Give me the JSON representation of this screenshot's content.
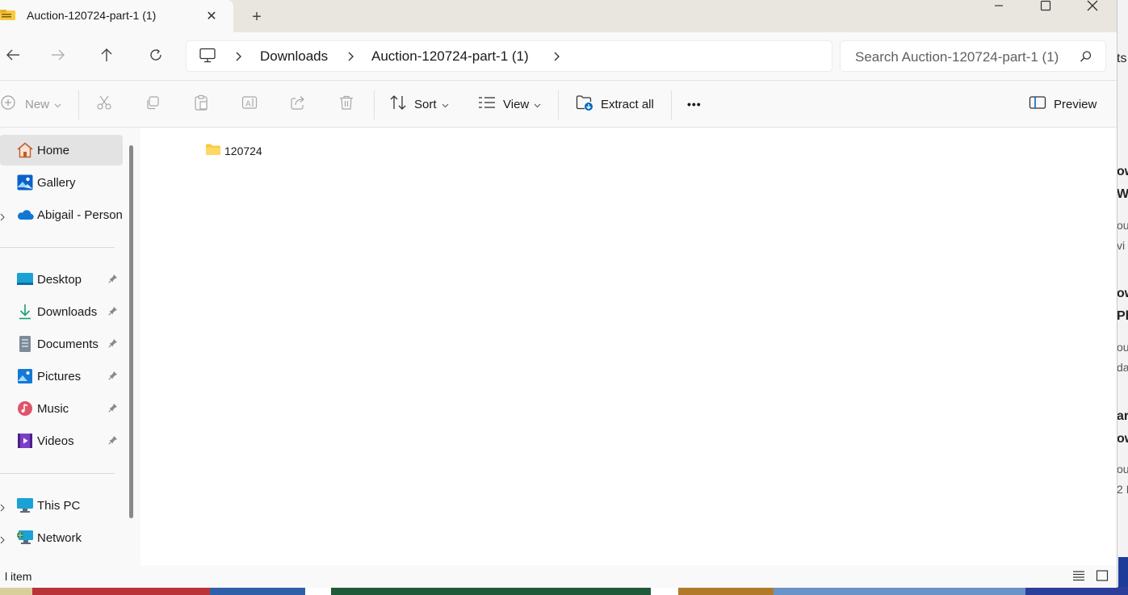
{
  "window": {
    "tab_title": "Auction-120724-part-1 (1)",
    "tab_close_glyph": "✕",
    "new_tab_glyph": "+"
  },
  "address_bar": {
    "crumbs": [
      "Downloads",
      "Auction-120724-part-1 (1)"
    ]
  },
  "search": {
    "placeholder": "Search Auction-120724-part-1 (1)"
  },
  "command_bar": {
    "new_label": "New",
    "sort_label": "Sort",
    "view_label": "View",
    "extract_label": "Extract all",
    "more_label": "•••",
    "preview_label": "Preview"
  },
  "sidebar": {
    "top_items": [
      {
        "label": "Home",
        "icon": "home-icon",
        "selected": true
      },
      {
        "label": "Gallery",
        "icon": "gallery-icon"
      },
      {
        "label": "Abigail - Person",
        "icon": "onedrive-icon"
      }
    ],
    "pinned_items": [
      {
        "label": "Desktop",
        "icon": "desktop-icon"
      },
      {
        "label": "Downloads",
        "icon": "download-icon"
      },
      {
        "label": "Documents",
        "icon": "document-icon"
      },
      {
        "label": "Pictures",
        "icon": "pictures-icon"
      },
      {
        "label": "Music",
        "icon": "music-icon"
      },
      {
        "label": "Videos",
        "icon": "videos-icon"
      }
    ],
    "bottom_items": [
      {
        "label": "This PC",
        "icon": "computer-icon"
      },
      {
        "label": "Network",
        "icon": "network-icon"
      }
    ]
  },
  "content": {
    "items": [
      {
        "name": "120724",
        "type": "folder"
      }
    ]
  },
  "status_bar": {
    "text": "l item"
  },
  "background_fragments": [
    "ts",
    "ow",
    "Win",
    "ou",
    "vi",
    "ow",
    "Ph",
    "ou",
    "da",
    "ar",
    "ow",
    "ou",
    "2 I"
  ],
  "colors": {
    "accent": "#0067c0",
    "folder_yellow": "#f8c93b",
    "titlebar": "#e9e6df"
  }
}
